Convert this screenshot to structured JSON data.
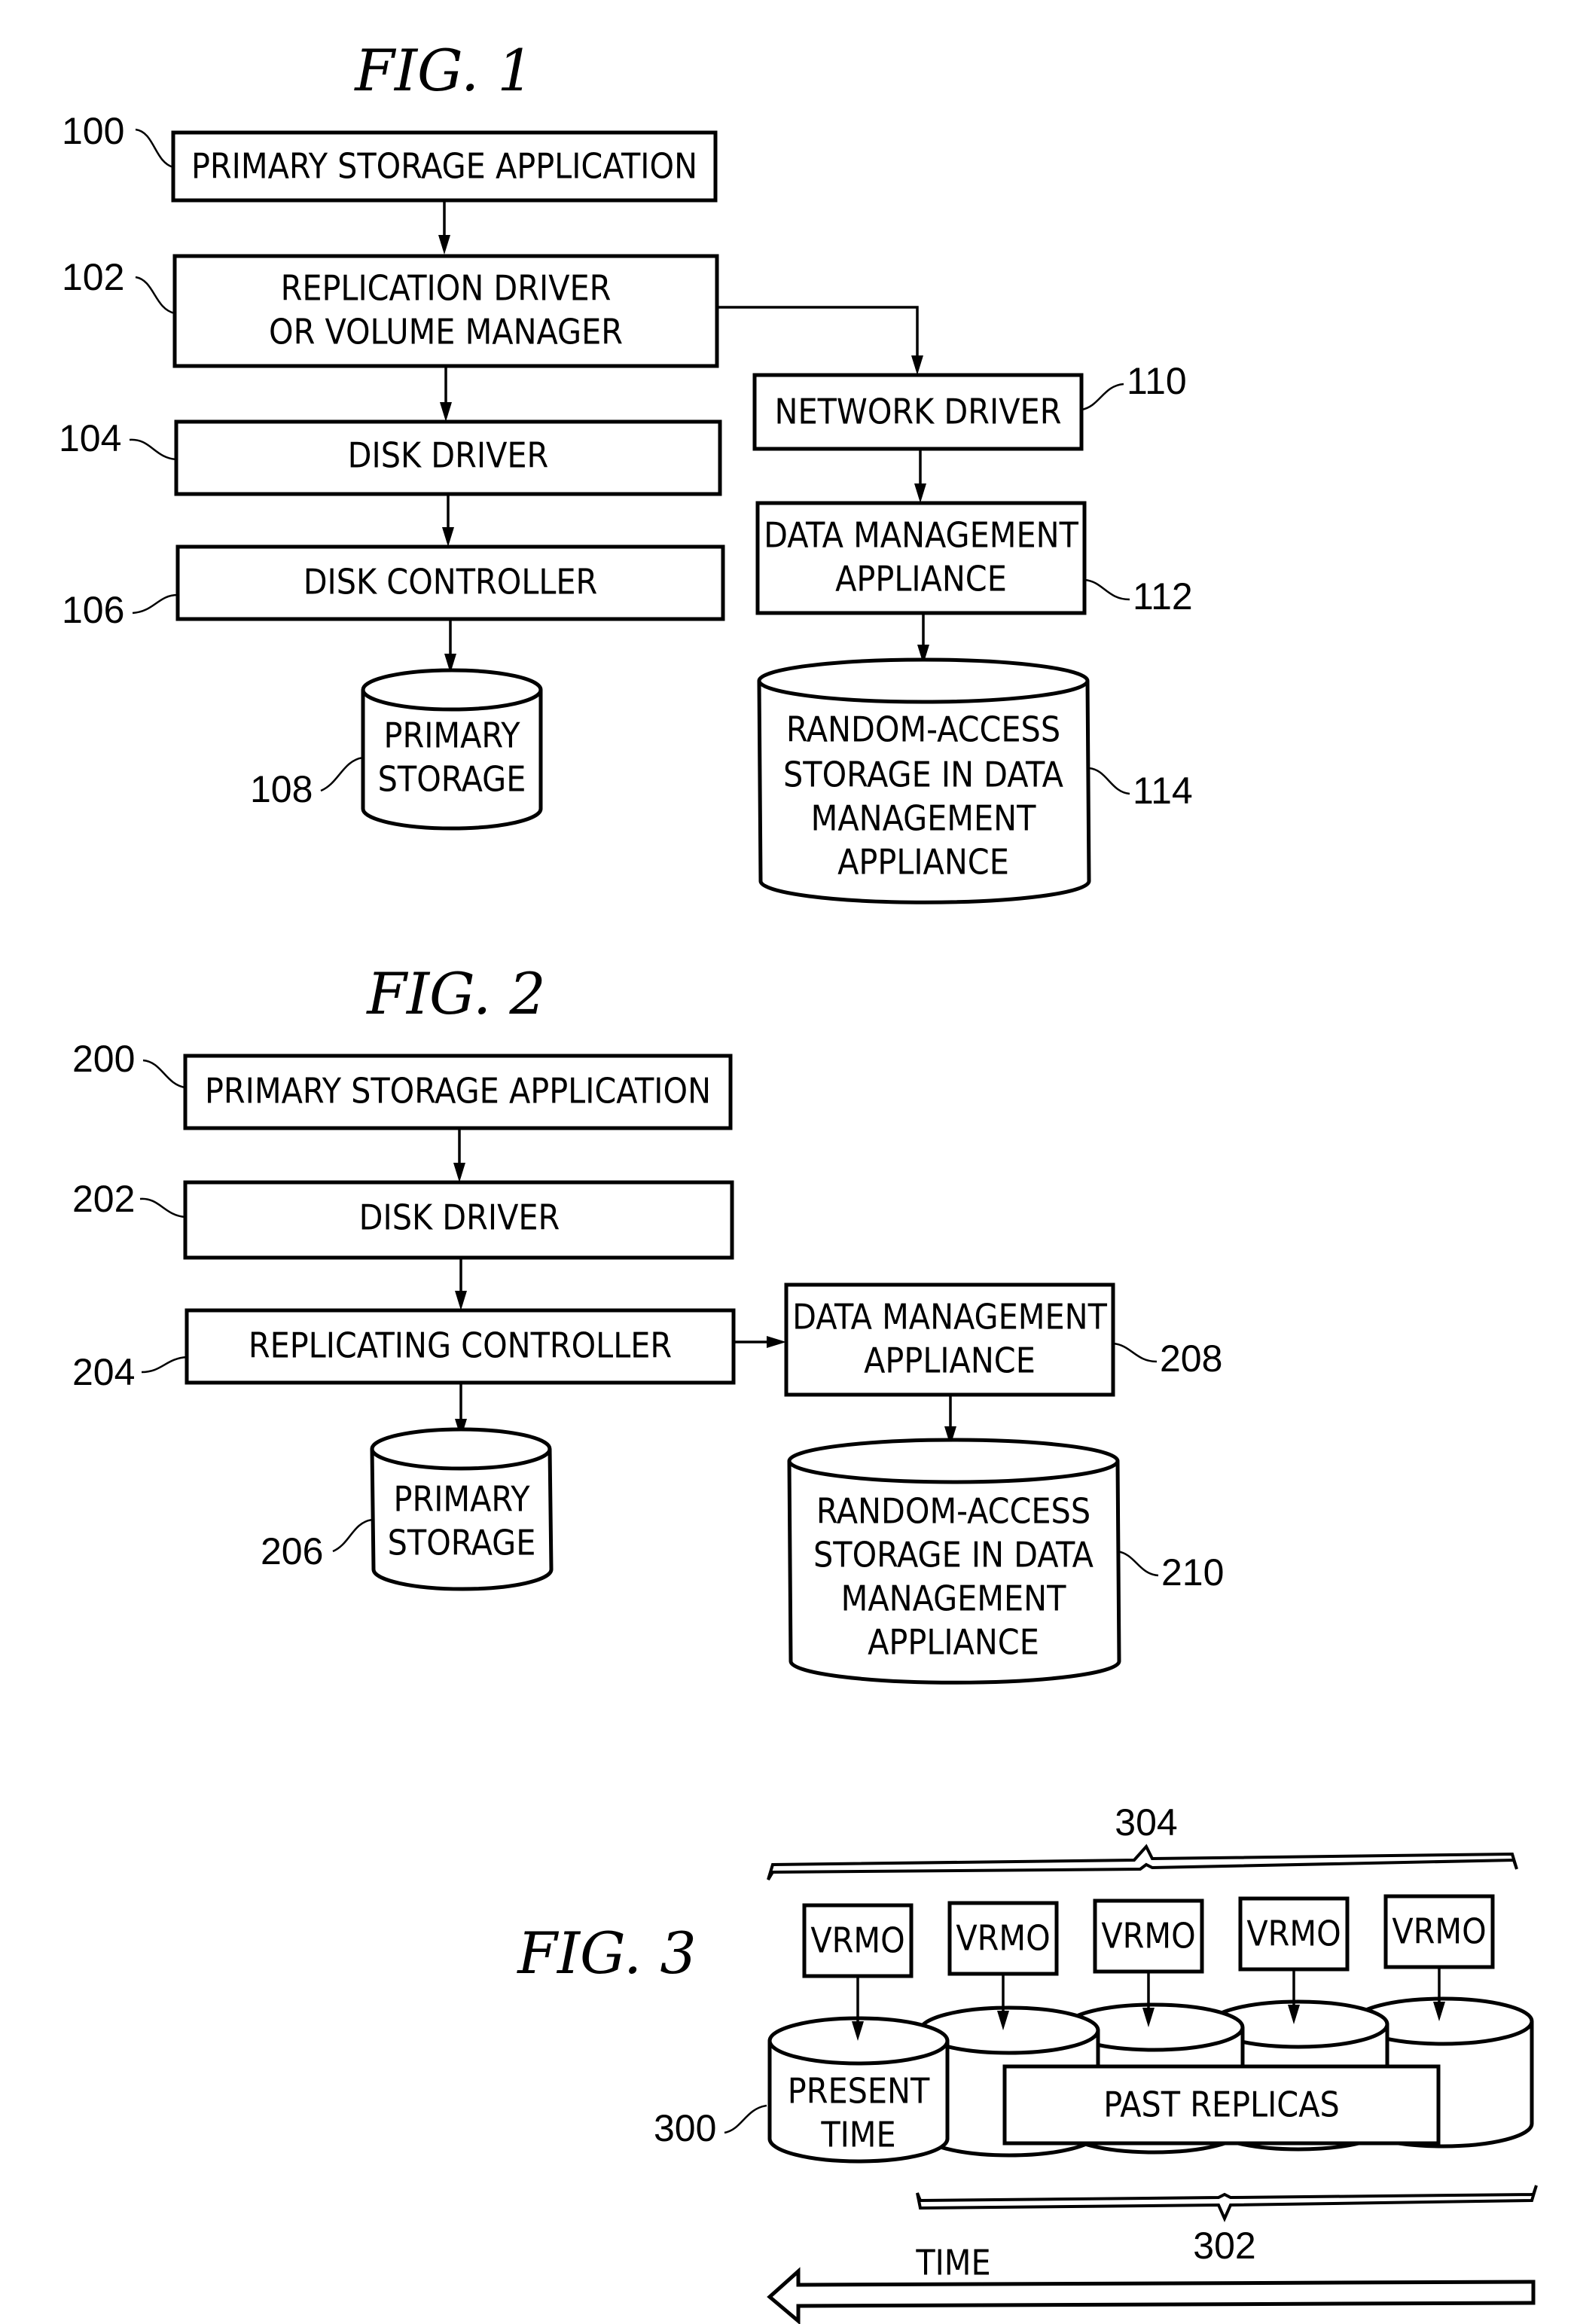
{
  "fig1": {
    "title": "FIG.  1",
    "boxes": {
      "b100": {
        "ref": "100",
        "lines": [
          "PRIMARY STORAGE APPLICATION"
        ]
      },
      "b102": {
        "ref": "102",
        "lines": [
          "REPLICATION DRIVER",
          "OR VOLUME MANAGER"
        ]
      },
      "b104": {
        "ref": "104",
        "lines": [
          "DISK DRIVER"
        ]
      },
      "b106": {
        "ref": "106",
        "lines": [
          "DISK CONTROLLER"
        ]
      },
      "b108": {
        "ref": "108",
        "lines": [
          "PRIMARY",
          "STORAGE"
        ]
      },
      "b110": {
        "ref": "110",
        "lines": [
          "NETWORK DRIVER"
        ]
      },
      "b112": {
        "ref": "112",
        "lines": [
          "DATA MANAGEMENT",
          "APPLIANCE"
        ]
      },
      "b114": {
        "ref": "114",
        "lines": [
          "RANDOM-ACCESS",
          "STORAGE IN DATA",
          "MANAGEMENT",
          "APPLIANCE"
        ]
      }
    }
  },
  "fig2": {
    "title": "FIG.  2",
    "boxes": {
      "b200": {
        "ref": "200",
        "lines": [
          "PRIMARY STORAGE APPLICATION"
        ]
      },
      "b202": {
        "ref": "202",
        "lines": [
          "DISK DRIVER"
        ]
      },
      "b204": {
        "ref": "204",
        "lines": [
          "REPLICATING CONTROLLER"
        ]
      },
      "b206": {
        "ref": "206",
        "lines": [
          "PRIMARY",
          "STORAGE"
        ]
      },
      "b208": {
        "ref": "208",
        "lines": [
          "DATA MANAGEMENT",
          "APPLIANCE"
        ]
      },
      "b210": {
        "ref": "210",
        "lines": [
          "RANDOM-ACCESS",
          "STORAGE IN DATA",
          "MANAGEMENT",
          "APPLIANCE"
        ]
      }
    }
  },
  "fig3": {
    "title": "FIG.  3",
    "vrmo_label": "VRMO",
    "vrmo_count": 5,
    "present": {
      "ref": "300",
      "lines": [
        "PRESENT",
        "TIME"
      ]
    },
    "past_replicas": {
      "ref": "302",
      "label": "PAST REPLICAS"
    },
    "vrmo_group_ref": "304",
    "time_label": "TIME",
    "time_direction": "left"
  }
}
